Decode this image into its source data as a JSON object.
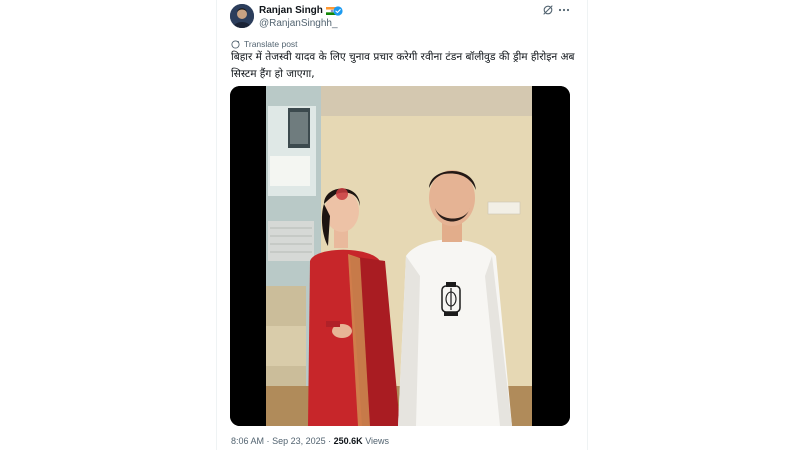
{
  "author": {
    "display_name": "Ranjan Singh",
    "handle": "@RanjanSinghh_",
    "flag_emoji_name": "india-flag",
    "verified_color": "#1d9bf0"
  },
  "translate": {
    "label": "Translate post"
  },
  "tweet": {
    "text": "बिहार में तेजस्वी यादव के लिए चुनाव प्रचार करेगी रवीना टंडन बॉलीवुड की ड्रीम हीरोइन अब सिस्टम हैंग हो जाएगा,"
  },
  "media": {
    "description_name": "photo"
  },
  "footer": {
    "time": "8:06 AM",
    "separator": "·",
    "date": "Sep 23, 2025",
    "views_count": "250.6K",
    "views_label": "Views"
  },
  "colors": {
    "accent": "#1d9bf0",
    "text": "#0f1419",
    "secondary": "#536471"
  }
}
